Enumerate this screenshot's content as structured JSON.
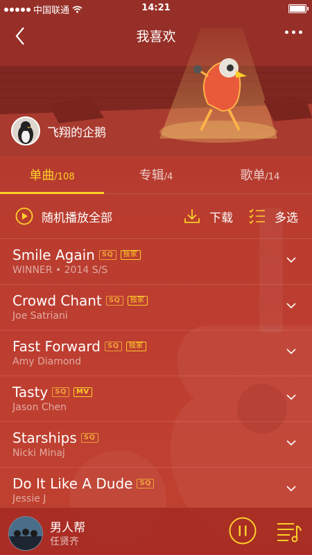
{
  "status": {
    "carrier": "中国联通",
    "time": "14:21"
  },
  "nav": {
    "title": "我喜欢"
  },
  "user": {
    "name": "飞翔的企鹅"
  },
  "tabs": [
    {
      "label": "单曲",
      "count": "/108"
    },
    {
      "label": "专辑",
      "count": "/4"
    },
    {
      "label": "歌单",
      "count": "/14"
    }
  ],
  "toolbar": {
    "play_all": "随机播放全部",
    "download": "下载",
    "multi_select": "多选"
  },
  "songs": [
    {
      "title": "Smile Again",
      "subtitle": "WINNER • 2014 S/S",
      "badges": [
        "SQ",
        "独家"
      ]
    },
    {
      "title": "Crowd Chant",
      "subtitle": "Joe Satriani",
      "badges": [
        "SQ",
        "独家"
      ]
    },
    {
      "title": "Fast Forward",
      "subtitle": "Amy Diamond",
      "badges": [
        "SQ",
        "独家"
      ]
    },
    {
      "title": "Tasty",
      "subtitle": "Jason Chen",
      "badges": [
        "SQ",
        "MV"
      ]
    },
    {
      "title": "Starships",
      "subtitle": "Nicki Minaj",
      "badges": [
        "SQ"
      ]
    },
    {
      "title": "Do It Like A Dude",
      "subtitle": "Jessie J",
      "badges": [
        "SQ"
      ]
    }
  ],
  "player": {
    "title": "男人帮",
    "artist": "任贤齐"
  },
  "colors": {
    "accent": "#ffcf2a",
    "background": "#b8382c",
    "badge_sq": "#f0a23a"
  }
}
